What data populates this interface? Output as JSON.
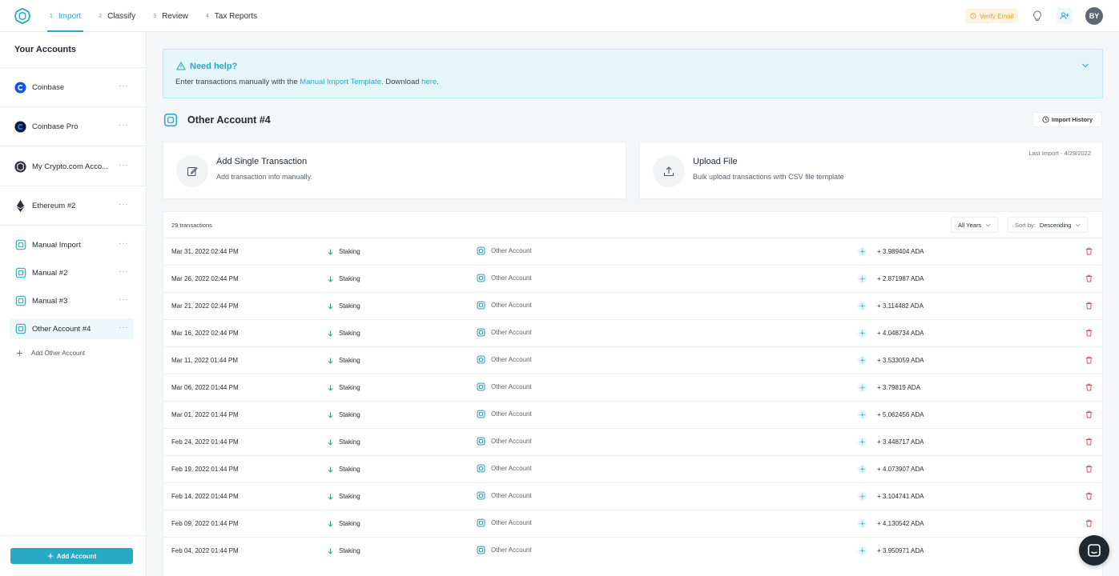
{
  "nav": {
    "steps": [
      {
        "num": "1",
        "label": "Import"
      },
      {
        "num": "2",
        "label": "Classify"
      },
      {
        "num": "3",
        "label": "Review"
      },
      {
        "num": "4",
        "label": "Tax Reports"
      }
    ],
    "verify_email": "Verify Email",
    "avatar_initials": "BY"
  },
  "sidebar": {
    "title": "Your Accounts",
    "accounts": [
      {
        "label": "Coinbase",
        "icon": "coinbase-icon"
      },
      {
        "label": "Coinbase Pro",
        "icon": "coinbase-pro-icon"
      },
      {
        "label": "My Crypto.com Acco...",
        "icon": "crypto-com-icon"
      },
      {
        "label": "Ethereum #2",
        "icon": "ethereum-icon"
      },
      {
        "label": "Manual Import",
        "icon": "manual-account-icon"
      },
      {
        "label": "Manual #2",
        "icon": "manual-account-icon"
      },
      {
        "label": "Manual #3",
        "icon": "manual-account-icon"
      },
      {
        "label": "Other Account #4",
        "icon": "manual-account-icon"
      }
    ],
    "add_other": "Add Other Account",
    "add_account": "Add Account"
  },
  "help": {
    "title": "Need help?",
    "text_before": "Enter transactions manually with the ",
    "template_link": "Manual Import Template",
    "text_middle": ". Download ",
    "here_link": "here",
    "text_after": "."
  },
  "account": {
    "title": "Other Account #4",
    "import_history": "Import History"
  },
  "cards": {
    "single": {
      "title": "Add Single Transaction",
      "subtitle": "Add transaction info manually."
    },
    "upload": {
      "title": "Upload File",
      "subtitle": "Bulk upload transactions with CSV file template",
      "last_import": "Last Import - 4/29/2022"
    }
  },
  "table": {
    "count": "29 transactions",
    "years": "All Years",
    "sort_label": "Sort by:",
    "sort_value": "Descending",
    "rows": [
      {
        "date": "Mar 31, 2022 02:44 PM",
        "type": "Staking",
        "account": "Other Account",
        "amount": "+ 3.989404 ADA"
      },
      {
        "date": "Mar 26, 2022 02:44 PM",
        "type": "Staking",
        "account": "Other Account",
        "amount": "+ 2.871987 ADA"
      },
      {
        "date": "Mar 21, 2022 02:44 PM",
        "type": "Staking",
        "account": "Other Account",
        "amount": "+ 3.114482 ADA"
      },
      {
        "date": "Mar 16, 2022 02:44 PM",
        "type": "Staking",
        "account": "Other Account",
        "amount": "+ 4.048734 ADA"
      },
      {
        "date": "Mar 11, 2022 01:44 PM",
        "type": "Staking",
        "account": "Other Account",
        "amount": "+ 3.533059 ADA"
      },
      {
        "date": "Mar 06, 2022 01:44 PM",
        "type": "Staking",
        "account": "Other Account",
        "amount": "+ 3.79819 ADA"
      },
      {
        "date": "Mar 01, 2022 01:44 PM",
        "type": "Staking",
        "account": "Other Account",
        "amount": "+ 5.062456 ADA"
      },
      {
        "date": "Feb 24, 2022 01:44 PM",
        "type": "Staking",
        "account": "Other Account",
        "amount": "+ 3.448717 ADA"
      },
      {
        "date": "Feb 19, 2022 01:44 PM",
        "type": "Staking",
        "account": "Other Account",
        "amount": "+ 4.073907 ADA"
      },
      {
        "date": "Feb 14, 2022 01:44 PM",
        "type": "Staking",
        "account": "Other Account",
        "amount": "+ 3.104741 ADA"
      },
      {
        "date": "Feb 09, 2022 01:44 PM",
        "type": "Staking",
        "account": "Other Account",
        "amount": "+ 4.130542 ADA"
      },
      {
        "date": "Feb 04, 2022 01:44 PM",
        "type": "Staking",
        "account": "Other Account",
        "amount": "+ 3.950971 ADA"
      }
    ]
  },
  "colors": {
    "accent": "#2aa9c7",
    "danger": "#e5484d",
    "warning": "#e1a23b"
  }
}
